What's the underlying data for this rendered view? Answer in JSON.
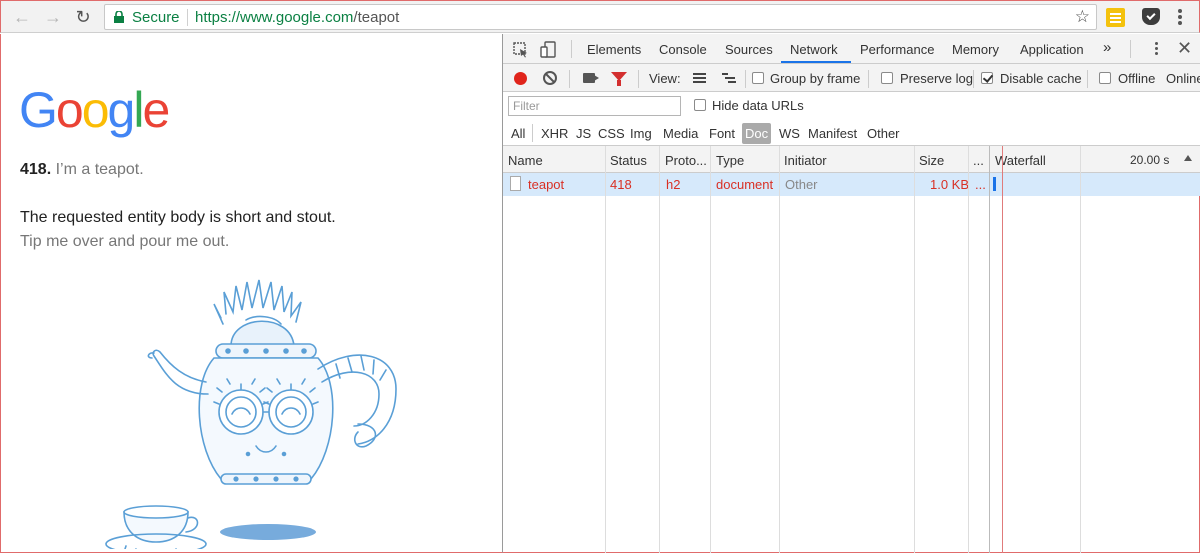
{
  "browser": {
    "secure_label": "Secure",
    "url_host": "https://www.google.com",
    "url_path": "/teapot"
  },
  "page": {
    "logo": "Google",
    "status_code": "418.",
    "status_message": "I’m a teapot.",
    "line1": "The requested entity body is short and stout.",
    "line2": "Tip me over and pour me out."
  },
  "devtools": {
    "tabs": [
      "Elements",
      "Console",
      "Sources",
      "Network",
      "Performance",
      "Memory",
      "Application"
    ],
    "more_tabs": "»",
    "active_tab": "Network",
    "controls": {
      "view_label": "View:",
      "group_by_frame": "Group by frame",
      "preserve_log": "Preserve log",
      "disable_cache": "Disable cache",
      "offline": "Offline",
      "online": "Online"
    },
    "filter_placeholder": "Filter",
    "hide_data_urls": "Hide data URLs",
    "types": [
      "All",
      "XHR",
      "JS",
      "CSS",
      "Img",
      "Media",
      "Font",
      "Doc",
      "WS",
      "Manifest",
      "Other"
    ],
    "selected_type": "Doc",
    "columns": {
      "name": "Name",
      "status": "Status",
      "protocol": "Proto...",
      "type": "Type",
      "initiator": "Initiator",
      "size": "Size",
      "time": "...",
      "waterfall": "Waterfall",
      "waterfall_time": "20.00 s"
    },
    "rows": [
      {
        "name": "teapot",
        "status": "418",
        "protocol": "h2",
        "type": "document",
        "initiator": "Other",
        "size": "1.0 KB",
        "time": "..."
      }
    ]
  },
  "colors": {
    "google_blue": "#4285F4",
    "google_red": "#EA4335",
    "google_yellow": "#FBBC05",
    "google_green": "#34A853",
    "secure_green": "#0b8043",
    "error_red": "#d93025",
    "selected_row": "#d6e9fb"
  }
}
